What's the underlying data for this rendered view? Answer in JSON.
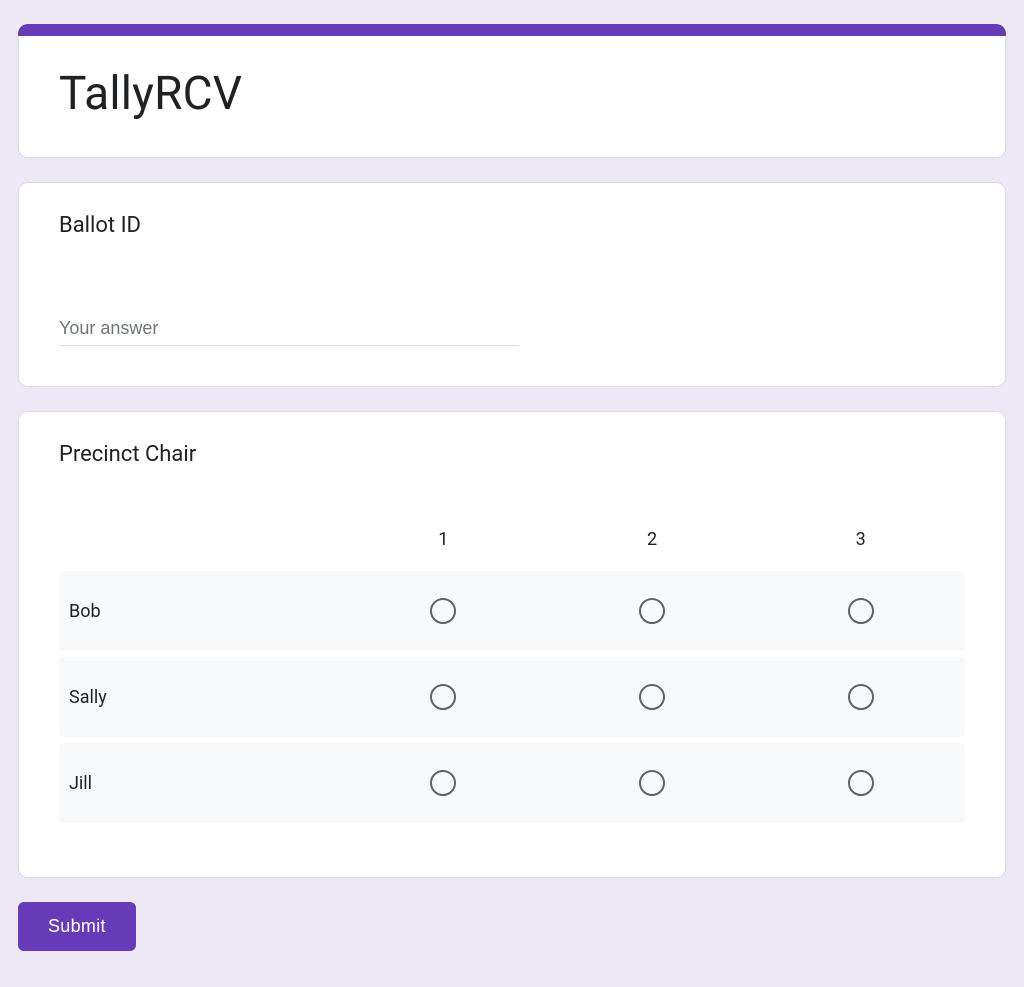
{
  "header": {
    "title": "TallyRCV"
  },
  "ballot_id": {
    "question": "Ballot ID",
    "placeholder": "Your answer",
    "value": ""
  },
  "precinct": {
    "question": "Precinct Chair",
    "rank_columns": [
      "1",
      "2",
      "3"
    ],
    "candidates": [
      "Bob",
      "Sally",
      "Jill"
    ]
  },
  "submit": {
    "label": "Submit"
  }
}
